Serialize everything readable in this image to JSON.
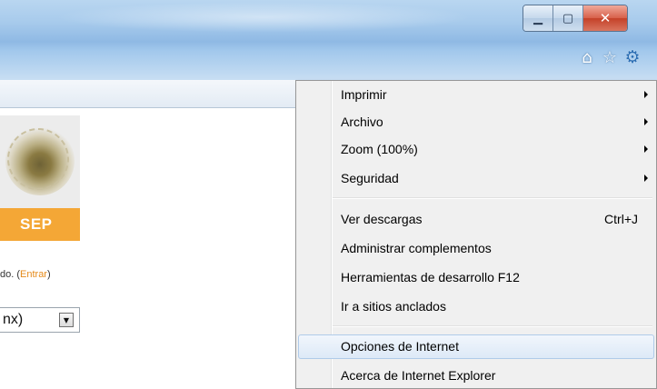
{
  "window": {
    "minimize_icon": "minimize-icon",
    "maximize_icon": "maximize-icon",
    "close_icon": "close-icon",
    "minimize_glyph": "▁",
    "maximize_glyph": "▢",
    "close_glyph": "✕"
  },
  "toolbar": {
    "icons": [
      {
        "name": "home-icon",
        "glyph": "⌂"
      },
      {
        "name": "favorites-star-icon",
        "glyph": "☆"
      },
      {
        "name": "tools-gear-icon",
        "glyph": "⚙"
      }
    ]
  },
  "page": {
    "logo_text": "SEP",
    "login_text": "do. (",
    "login_link": "Entrar",
    "login_close": ")",
    "language_value": "nx)"
  },
  "menu": {
    "groups": [
      [
        {
          "label": "Imprimir",
          "submenu": true
        },
        {
          "label": "Archivo",
          "submenu": true
        },
        {
          "label": "Zoom (100%)",
          "submenu": true
        },
        {
          "label": "Seguridad",
          "submenu": true
        }
      ],
      [
        {
          "label": "Ver descargas",
          "shortcut": "Ctrl+J"
        },
        {
          "label": "Administrar complementos"
        },
        {
          "label": "Herramientas de desarrollo F12"
        },
        {
          "label": "Ir a sitios anclados"
        }
      ],
      [
        {
          "label": "Opciones de Internet",
          "highlighted": true
        },
        {
          "label": "Acerca de Internet Explorer"
        }
      ]
    ]
  },
  "colors": {
    "accent_orange": "#f4a736",
    "link_orange": "#e58a1a",
    "close_red": "#c44128"
  }
}
